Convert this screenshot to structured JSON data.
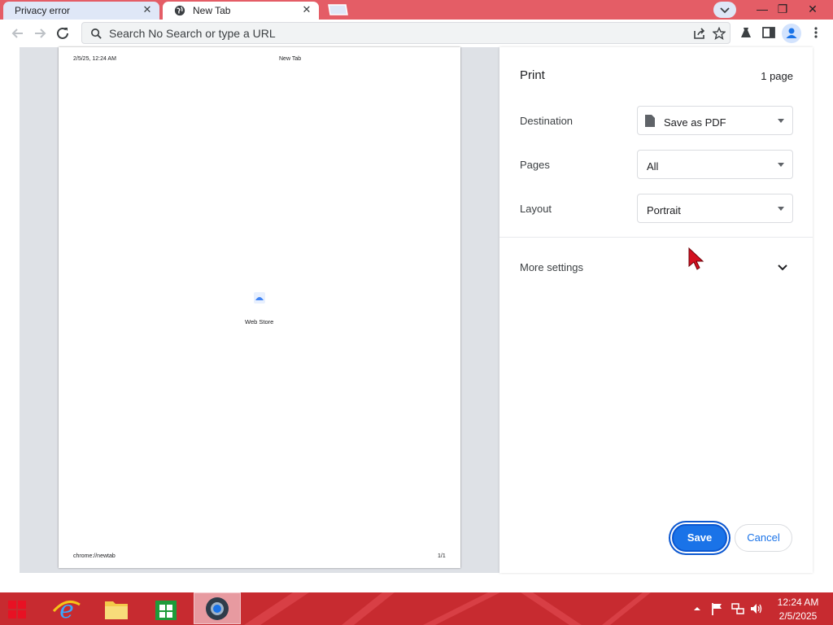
{
  "browser": {
    "tabs": [
      {
        "title": "Privacy error",
        "close": "✕"
      },
      {
        "title": "New Tab",
        "close": "✕"
      }
    ],
    "window_controls": {
      "minimize": "—",
      "restore": "❐",
      "close": "✕"
    },
    "omnibox": {
      "text": "Search No Search or type a URL"
    },
    "icons": [
      "back-icon",
      "forward-icon",
      "reload-icon",
      "search-icon",
      "share-icon",
      "star-icon",
      "extensions-icon",
      "side-panel-icon",
      "profile-icon",
      "menu-icon"
    ]
  },
  "print_preview": {
    "page": {
      "header_left": "2/5/25, 12:24 AM",
      "header_center": "New Tab",
      "center_label": "Web Store",
      "footer_left": "chrome://newtab",
      "footer_right": "1/1"
    },
    "settings": {
      "title": "Print",
      "page_count": "1 page",
      "destination": {
        "label": "Destination",
        "value": "Save as PDF"
      },
      "pages": {
        "label": "Pages",
        "value": "All"
      },
      "layout": {
        "label": "Layout",
        "value": "Portrait"
      },
      "more_settings": "More settings",
      "save_button": "Save",
      "cancel_button": "Cancel"
    }
  },
  "taskbar": {
    "apps": [
      "start-icon",
      "internet-explorer-icon",
      "file-explorer-icon",
      "store-icon",
      "chrome-icon"
    ],
    "time": "12:24 AM",
    "date": "2/5/2025"
  },
  "colors": {
    "tabstrip": "#e45d66",
    "accent_blue": "#1a73e8",
    "taskbar": "#c72b30",
    "preview_bg": "#dee1e6"
  }
}
